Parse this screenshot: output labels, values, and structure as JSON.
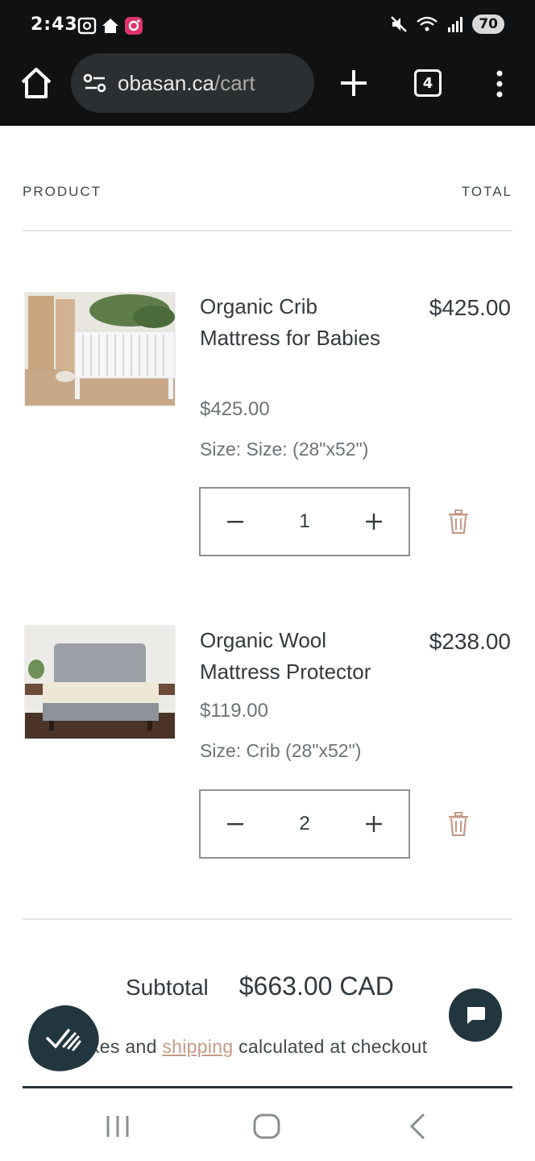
{
  "status_bar": {
    "time": "2:43",
    "battery": "70",
    "icons": [
      "screenshot-icon",
      "home-icon",
      "instagram-icon",
      "mute-icon",
      "wifi-icon",
      "signal-icon"
    ]
  },
  "browser": {
    "url_domain": "obasan.ca",
    "url_path": "/cart",
    "tab_count": "4"
  },
  "cart": {
    "header_product": "PRODUCT",
    "header_total": "TOTAL",
    "items": [
      {
        "title": "Organic Crib Mattress for Babies",
        "total": "$425.00",
        "price": "$425.00",
        "size": "Size: Size: (28\"x52\")",
        "quantity": "1"
      },
      {
        "title": "Organic Wool Mattress Protector",
        "total": "$238.00",
        "price": "$119.00",
        "size": "Size: Crib (28\"x52\")",
        "quantity": "2"
      }
    ],
    "subtotal_label": "Subtotal",
    "subtotal_value": "$663.00 CAD",
    "taxes_prefix": "xes and ",
    "taxes_link": "shipping",
    "taxes_suffix": " calculated at checkout"
  },
  "colors": {
    "accent_link": "#c49a87",
    "dark_button": "#22363f",
    "trash_icon": "#c49a87"
  }
}
